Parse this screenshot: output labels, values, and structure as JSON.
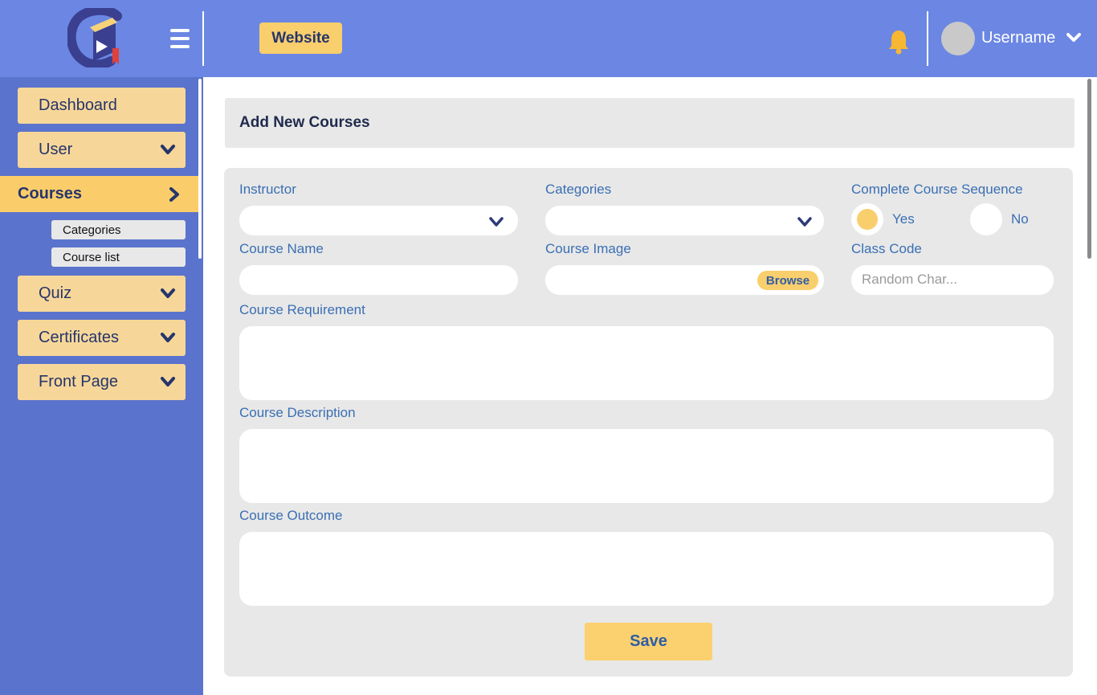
{
  "header": {
    "logo_icon": "course-book-logo",
    "menu_icon": "hamburger-icon",
    "website_label": "Website",
    "notification_icon": "bell-icon",
    "username": "Username",
    "user_menu_icon": "chevron-down-icon",
    "colors": {
      "bar": "#6b87e3",
      "accent": "#f9ce6d",
      "bell": "#f7b733"
    }
  },
  "sidebar": {
    "items": [
      {
        "label": "Dashboard"
      },
      {
        "label": "User",
        "icon": "chevron-down-icon"
      },
      {
        "label": "Courses",
        "icon": "chevron-right-icon",
        "active": true,
        "subitems": [
          {
            "label": "Categories"
          },
          {
            "label": "Course list"
          }
        ]
      },
      {
        "label": "Quiz",
        "icon": "chevron-down-icon"
      },
      {
        "label": "Certificates",
        "icon": "chevron-down-icon"
      },
      {
        "label": "Front Page",
        "icon": "chevron-down-icon"
      }
    ],
    "colors": {
      "background": "#5a73cc",
      "item": "#f7d799",
      "active": "#fbcd6a"
    }
  },
  "main": {
    "title": "Add New Courses",
    "form": {
      "instructor": {
        "label": "Instructor",
        "value": ""
      },
      "categories": {
        "label": "Categories",
        "value": ""
      },
      "sequence": {
        "label": "Complete Course Sequence",
        "yes_label": "Yes",
        "no_label": "No",
        "selected": "Yes"
      },
      "course_name": {
        "label": "Course Name",
        "value": ""
      },
      "course_image": {
        "label": "Course Image",
        "browse_label": "Browse"
      },
      "class_code": {
        "label": "Class Code",
        "placeholder": "Random Char..."
      },
      "requirement": {
        "label": "Course Requirement",
        "value": ""
      },
      "description": {
        "label": "Course Description",
        "value": ""
      },
      "outcome": {
        "label": "Course Outcome",
        "value": ""
      },
      "save_label": "Save"
    }
  }
}
